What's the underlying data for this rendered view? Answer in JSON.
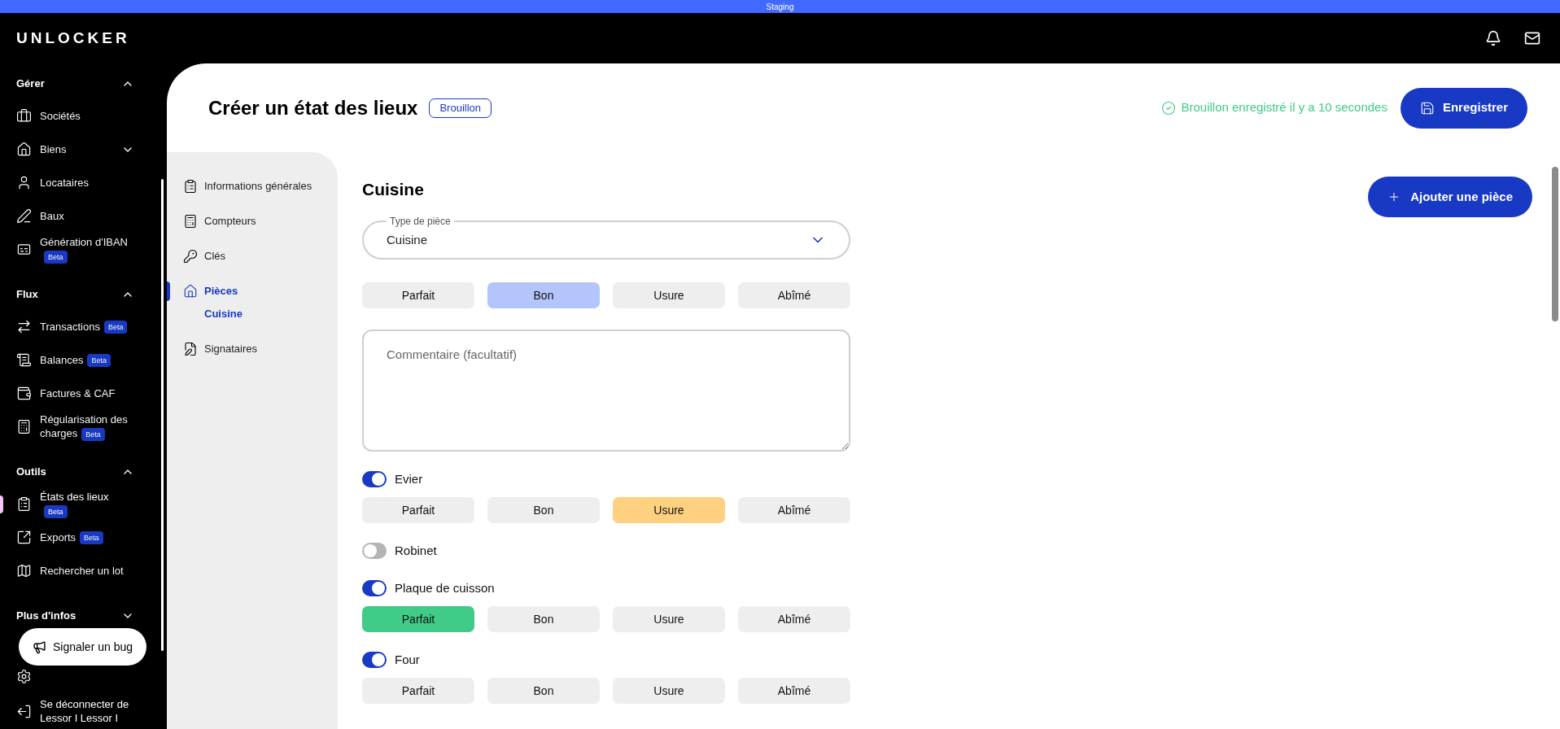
{
  "env_banner": "Staging",
  "logo": "UNLOCKER",
  "sidebar": {
    "sections": [
      {
        "title": "Gérer",
        "expanded": true,
        "items": [
          {
            "label": "Sociétés",
            "selected": false
          },
          {
            "label": "Biens",
            "selected": false,
            "expanded": false
          },
          {
            "label": "Locataires",
            "selected": false
          },
          {
            "label": "Baux",
            "selected": false
          },
          {
            "label": "Génération d'IBAN",
            "badge": "Beta",
            "selected": false
          }
        ]
      },
      {
        "title": "Flux",
        "expanded": true,
        "items": [
          {
            "label": "Transactions",
            "badge": "Beta",
            "selected": false
          },
          {
            "label": "Balances",
            "badge": "Beta",
            "selected": false
          },
          {
            "label": "Factures & CAF",
            "selected": false
          },
          {
            "label": "Régularisation des charges",
            "badge": "Beta",
            "selected": false
          }
        ]
      },
      {
        "title": "Outils",
        "expanded": true,
        "items": [
          {
            "label": "États des lieux",
            "badge": "Beta",
            "selected": true
          },
          {
            "label": "Exports",
            "badge": "Beta",
            "selected": false
          },
          {
            "label": "Rechercher un lot",
            "selected": false
          }
        ]
      },
      {
        "title": "Plus d'infos",
        "expanded": false
      }
    ],
    "logout": "Se déconnecter de Lessor I Lessor I"
  },
  "bug_button": "Signaler un bug",
  "page": {
    "title": "Créer un état des lieux",
    "status": "Brouillon",
    "save_status": "Brouillon enregistré il y a 10 secondes",
    "save_button": "Enregistrer"
  },
  "steps": [
    {
      "label": "Informations générales",
      "selected": false
    },
    {
      "label": "Compteurs",
      "selected": false
    },
    {
      "label": "Clés",
      "selected": false
    },
    {
      "label": "Pièces",
      "selected": true,
      "children": [
        {
          "label": "Cuisine",
          "selected": true
        }
      ]
    },
    {
      "label": "Signataires",
      "selected": false
    }
  ],
  "room": {
    "title": "Cuisine",
    "add_button": "Ajouter une pièce",
    "room_type": {
      "label": "Type de pièce",
      "value": "Cuisine"
    },
    "ratings": [
      {
        "label": "Parfait",
        "selected": false
      },
      {
        "label": "Bon",
        "selected": true
      },
      {
        "label": "Usure",
        "selected": false
      },
      {
        "label": "Abîmé",
        "selected": false
      }
    ],
    "comment": {
      "placeholder": "Commentaire (facultatif)"
    },
    "elements": [
      {
        "label": "Evier",
        "on": true,
        "ratings": [
          {
            "label": "Parfait",
            "selected": false
          },
          {
            "label": "Bon",
            "selected": false
          },
          {
            "label": "Usure",
            "selected": true
          },
          {
            "label": "Abîmé",
            "selected": false
          }
        ]
      },
      {
        "label": "Robinet",
        "on": false
      },
      {
        "label": "Plaque de cuisson",
        "on": true,
        "ratings": [
          {
            "label": "Parfait",
            "selected": true
          },
          {
            "label": "Bon",
            "selected": false
          },
          {
            "label": "Usure",
            "selected": false
          },
          {
            "label": "Abîmé",
            "selected": false
          }
        ]
      },
      {
        "label": "Four",
        "on": true,
        "ratings": [
          {
            "label": "Parfait",
            "selected": false
          },
          {
            "label": "Bon",
            "selected": false
          },
          {
            "label": "Usure",
            "selected": false
          },
          {
            "label": "Abîmé",
            "selected": false
          }
        ]
      }
    ]
  }
}
